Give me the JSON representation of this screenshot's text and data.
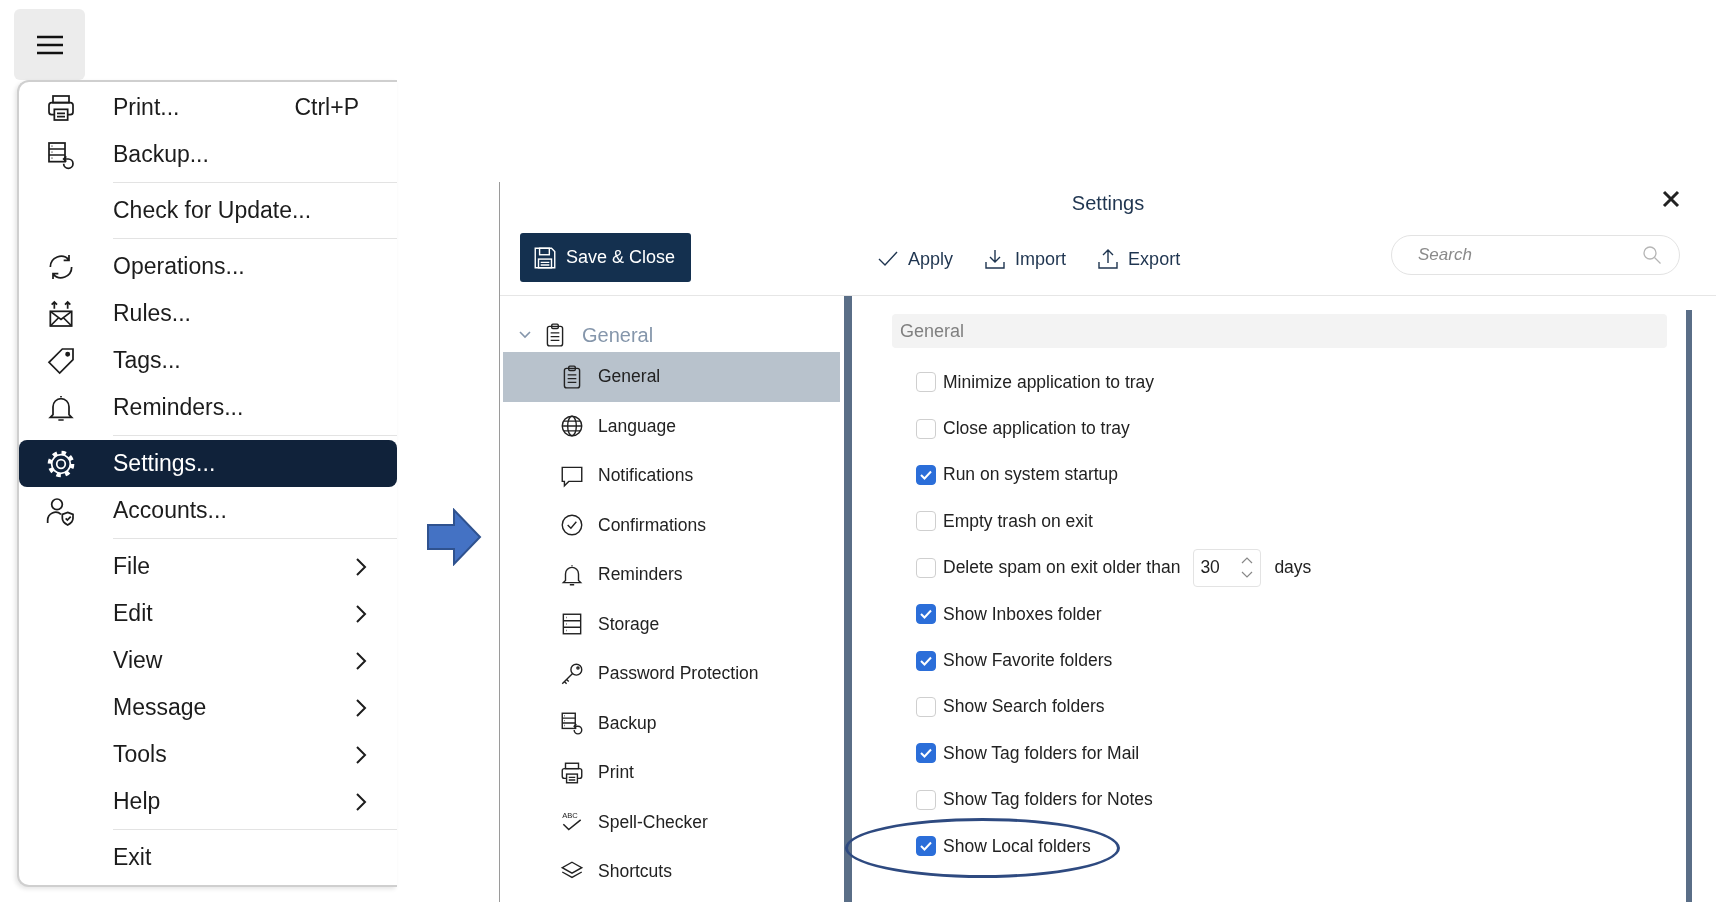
{
  "menu": {
    "groups": [
      [
        {
          "kind": "command",
          "label": "Print...",
          "shortcut": "Ctrl+P",
          "selected": false
        },
        {
          "kind": "command",
          "label": "Backup...",
          "selected": false
        }
      ],
      [
        {
          "kind": "command",
          "label": "Check for Update...",
          "selected": false
        }
      ],
      [
        {
          "kind": "command",
          "label": "Operations...",
          "selected": false
        },
        {
          "kind": "command",
          "label": "Rules...",
          "selected": false
        },
        {
          "kind": "command",
          "label": "Tags...",
          "selected": false
        },
        {
          "kind": "command",
          "label": "Reminders...",
          "selected": false
        }
      ],
      [
        {
          "kind": "command",
          "label": "Settings...",
          "selected": true
        },
        {
          "kind": "command",
          "label": "Accounts...",
          "selected": false
        }
      ],
      [
        {
          "kind": "submenu",
          "label": "File",
          "selected": false
        },
        {
          "kind": "submenu",
          "label": "Edit",
          "selected": false
        },
        {
          "kind": "submenu",
          "label": "View",
          "selected": false
        },
        {
          "kind": "submenu",
          "label": "Message",
          "selected": false
        },
        {
          "kind": "submenu",
          "label": "Tools",
          "selected": false
        },
        {
          "kind": "submenu",
          "label": "Help",
          "selected": false
        }
      ],
      [
        {
          "kind": "command",
          "label": "Exit",
          "selected": false
        }
      ]
    ]
  },
  "dialog": {
    "title": "Settings",
    "toolbar": {
      "save_button": "Save & Close",
      "actions": [
        "Apply",
        "Import",
        "Export"
      ],
      "search": {
        "placeholder": "Search"
      }
    },
    "sidebar": {
      "items": [
        {
          "label": "General",
          "expanded": true,
          "selected": false,
          "children": [
            {
              "label": "General",
              "selected": true
            },
            {
              "label": "Language",
              "selected": false
            },
            {
              "label": "Notifications",
              "selected": false
            },
            {
              "label": "Confirmations",
              "selected": false
            },
            {
              "label": "Reminders",
              "selected": false
            },
            {
              "label": "Storage",
              "selected": false
            },
            {
              "label": "Password Protection",
              "selected": false
            },
            {
              "label": "Backup",
              "selected": false
            },
            {
              "label": "Print",
              "selected": false
            },
            {
              "label": "Spell-Checker",
              "selected": false,
              "icon_text": "ABC"
            },
            {
              "label": "Shortcuts",
              "selected": false
            }
          ]
        }
      ]
    },
    "section": {
      "title": "General",
      "options": [
        {
          "kind": "checkbox",
          "label": "Minimize application to tray",
          "checked": false,
          "highlighted": false
        },
        {
          "kind": "checkbox",
          "label": "Close application to tray",
          "checked": false,
          "highlighted": false
        },
        {
          "kind": "checkbox",
          "label": "Run on system startup",
          "checked": true,
          "highlighted": false
        },
        {
          "kind": "checkbox",
          "label": "Empty trash on exit",
          "checked": false,
          "highlighted": false
        },
        {
          "kind": "number",
          "label": "Delete spam on exit older than",
          "checked": false,
          "value": "30",
          "suffix": "days",
          "highlighted": false
        },
        {
          "kind": "checkbox",
          "label": "Show Inboxes folder",
          "checked": true,
          "highlighted": false
        },
        {
          "kind": "checkbox",
          "label": "Show Favorite folders",
          "checked": true,
          "highlighted": false
        },
        {
          "kind": "checkbox",
          "label": "Show Search folders",
          "checked": false,
          "highlighted": false
        },
        {
          "kind": "checkbox",
          "label": "Show Tag folders for Mail",
          "checked": true,
          "highlighted": false
        },
        {
          "kind": "checkbox",
          "label": "Show Tag folders for Notes",
          "checked": false,
          "highlighted": false
        },
        {
          "kind": "checkbox",
          "label": "Show Local folders",
          "checked": true,
          "highlighted": true
        }
      ]
    }
  }
}
